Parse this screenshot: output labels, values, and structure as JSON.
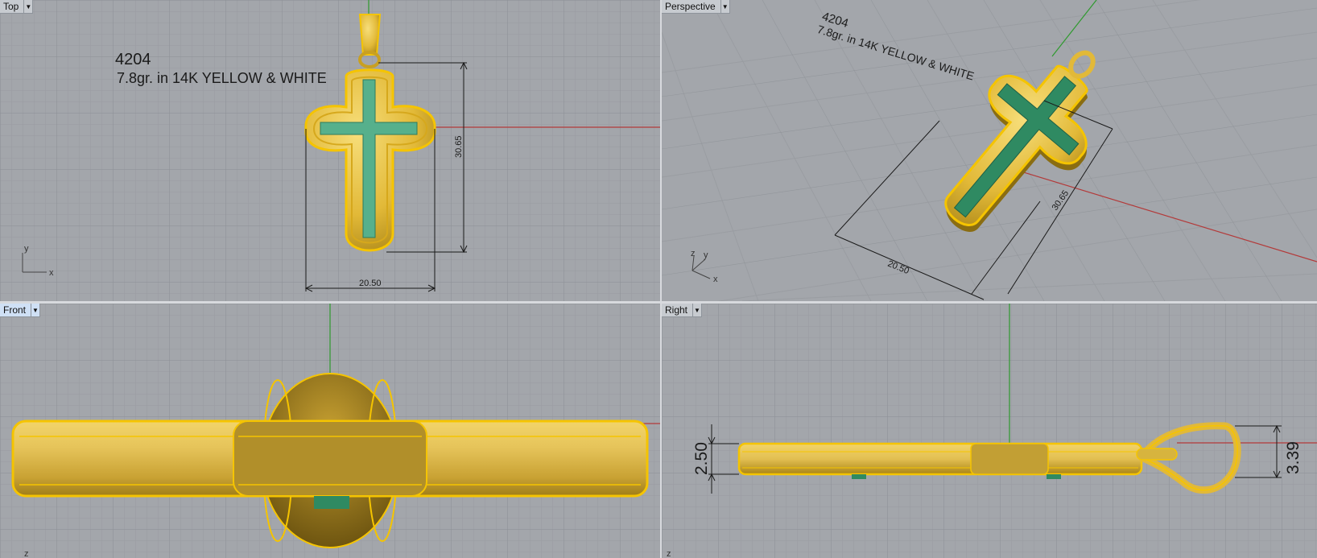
{
  "viewports": {
    "top": {
      "label": "Top",
      "menu_icon": "dropdown-arrow",
      "product_code": "4204",
      "spec": "7.8gr. in 14K YELLOW & WHITE",
      "dim_height": "30.65",
      "dim_width": "20.50",
      "axis_y": "y",
      "axis_x": "x"
    },
    "perspective": {
      "label": "Perspective",
      "menu_icon": "dropdown-arrow",
      "product_code": "4204",
      "spec": "7.8gr. in 14K YELLOW & WHITE",
      "dim_height": "30.65",
      "dim_width": "20.50",
      "axis_z": "z",
      "axis_y": "y",
      "axis_x": "x"
    },
    "front": {
      "label": "Front",
      "menu_icon": "dropdown-arrow",
      "axis_z": "z"
    },
    "right": {
      "label": "Right",
      "menu_icon": "dropdown-arrow",
      "dim_thickness": "2.50",
      "dim_bail": "3.39",
      "axis_z": "z"
    }
  },
  "colors": {
    "viewport_bg": "#a3a6ab",
    "grid_minor": "#9a9da2",
    "grid_major": "#8c9095",
    "gold": "#e7c24a",
    "gold_dark": "#a98416",
    "enamel": "#4aa882",
    "x_axis": "#b33a3a",
    "y_axis": "#2f9a2f"
  }
}
